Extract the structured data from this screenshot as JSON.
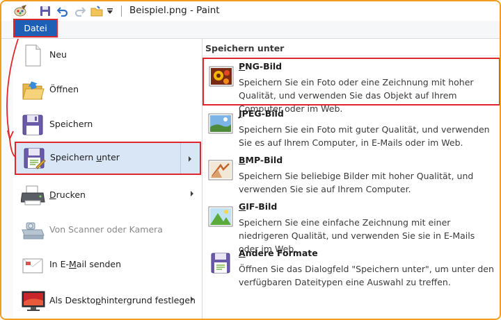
{
  "window": {
    "title": "Beispiel.png - Paint"
  },
  "quick_access": [
    {
      "icon": "paint-app-icon"
    },
    {
      "icon": "save-icon"
    },
    {
      "icon": "undo-icon"
    },
    {
      "icon": "redo-icon"
    },
    {
      "icon": "folder-icon"
    },
    {
      "icon": "customize-dropdown-icon"
    }
  ],
  "ribbon": {
    "file_tab_label": "Datei"
  },
  "menu": {
    "items": [
      {
        "label": "Neu",
        "icon": "new-document-icon",
        "has_submenu": false,
        "enabled": true
      },
      {
        "label": "Öffnen",
        "icon": "open-folder-icon",
        "has_submenu": false,
        "enabled": true
      },
      {
        "label": "Speichern",
        "icon": "save-disk-icon",
        "has_submenu": false,
        "enabled": true
      },
      {
        "label": "Speichern unter",
        "icon": "save-as-icon",
        "has_submenu": true,
        "enabled": true,
        "selected": true
      },
      {
        "label": "Drucken",
        "icon": "printer-icon",
        "has_submenu": true,
        "enabled": true
      },
      {
        "label": "Von Scanner oder Kamera",
        "icon": "scanner-icon",
        "has_submenu": false,
        "enabled": false
      },
      {
        "label": "In E-Mail senden",
        "icon": "email-icon",
        "has_submenu": false,
        "enabled": true
      },
      {
        "label": "Als Desktophintergrund festlegen",
        "icon": "desktop-background-icon",
        "has_submenu": true,
        "enabled": true
      }
    ]
  },
  "save_as_pane": {
    "header": "Speichern unter",
    "formats": [
      {
        "title": "PNG-Bild",
        "description": "Speichern Sie ein Foto oder eine Zeichnung mit hoher Qualität, und verwenden Sie das Objekt auf Ihrem Computer oder im Web.",
        "icon": "png-image-icon",
        "highlighted": true
      },
      {
        "title": "JPEG-Bild",
        "description": "Speichern Sie ein Foto mit guter Qualität, und verwenden Sie es auf Ihrem Computer, in E-Mails oder im Web.",
        "icon": "jpeg-image-icon"
      },
      {
        "title": "BMP-Bild",
        "description": "Speichern Sie beliebige Bilder mit hoher Qualität, und verwenden Sie sie auf Ihrem Computer.",
        "icon": "bmp-image-icon"
      },
      {
        "title": "GIF-Bild",
        "description": "Speichern Sie eine einfache Zeichnung mit einer niedrigeren Qualität, und verwenden Sie sie in E-Mails oder im Web.",
        "icon": "gif-image-icon"
      },
      {
        "title": "Andere Formate",
        "description": "Öffnen Sie das Dialogfeld \"Speichern unter\", um unter den verfügbaren Dateitypen eine Auswahl zu treffen.",
        "icon": "other-formats-icon"
      }
    ]
  },
  "colors": {
    "accent": "#1c5fb5",
    "highlight_border": "#e0262b",
    "frame": "#f39c1f",
    "selected_bg": "#d8e6f6"
  }
}
